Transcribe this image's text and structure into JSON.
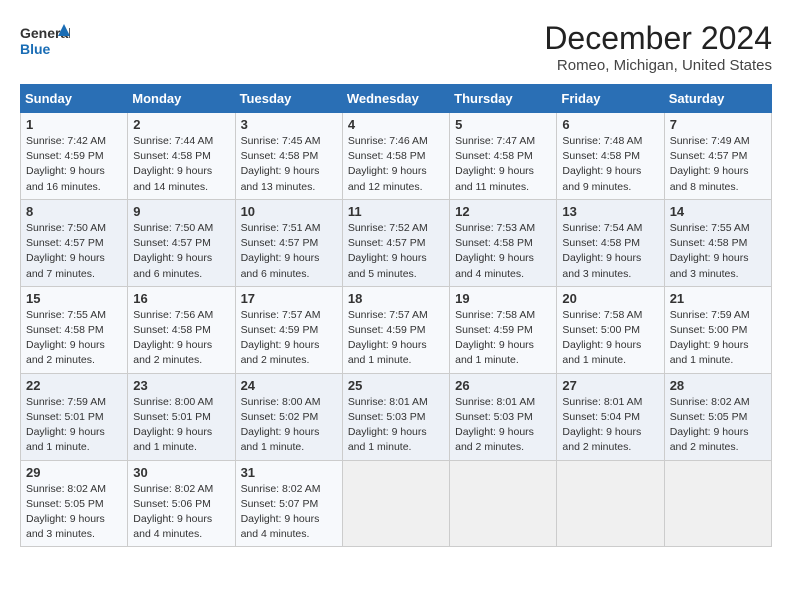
{
  "header": {
    "logo_line1": "General",
    "logo_line2": "Blue",
    "month": "December 2024",
    "location": "Romeo, Michigan, United States"
  },
  "weekdays": [
    "Sunday",
    "Monday",
    "Tuesday",
    "Wednesday",
    "Thursday",
    "Friday",
    "Saturday"
  ],
  "weeks": [
    [
      {
        "day": "1",
        "info": "Sunrise: 7:42 AM\nSunset: 4:59 PM\nDaylight: 9 hours\nand 16 minutes."
      },
      {
        "day": "2",
        "info": "Sunrise: 7:44 AM\nSunset: 4:58 PM\nDaylight: 9 hours\nand 14 minutes."
      },
      {
        "day": "3",
        "info": "Sunrise: 7:45 AM\nSunset: 4:58 PM\nDaylight: 9 hours\nand 13 minutes."
      },
      {
        "day": "4",
        "info": "Sunrise: 7:46 AM\nSunset: 4:58 PM\nDaylight: 9 hours\nand 12 minutes."
      },
      {
        "day": "5",
        "info": "Sunrise: 7:47 AM\nSunset: 4:58 PM\nDaylight: 9 hours\nand 11 minutes."
      },
      {
        "day": "6",
        "info": "Sunrise: 7:48 AM\nSunset: 4:58 PM\nDaylight: 9 hours\nand 9 minutes."
      },
      {
        "day": "7",
        "info": "Sunrise: 7:49 AM\nSunset: 4:57 PM\nDaylight: 9 hours\nand 8 minutes."
      }
    ],
    [
      {
        "day": "8",
        "info": "Sunrise: 7:50 AM\nSunset: 4:57 PM\nDaylight: 9 hours\nand 7 minutes."
      },
      {
        "day": "9",
        "info": "Sunrise: 7:50 AM\nSunset: 4:57 PM\nDaylight: 9 hours\nand 6 minutes."
      },
      {
        "day": "10",
        "info": "Sunrise: 7:51 AM\nSunset: 4:57 PM\nDaylight: 9 hours\nand 6 minutes."
      },
      {
        "day": "11",
        "info": "Sunrise: 7:52 AM\nSunset: 4:57 PM\nDaylight: 9 hours\nand 5 minutes."
      },
      {
        "day": "12",
        "info": "Sunrise: 7:53 AM\nSunset: 4:58 PM\nDaylight: 9 hours\nand 4 minutes."
      },
      {
        "day": "13",
        "info": "Sunrise: 7:54 AM\nSunset: 4:58 PM\nDaylight: 9 hours\nand 3 minutes."
      },
      {
        "day": "14",
        "info": "Sunrise: 7:55 AM\nSunset: 4:58 PM\nDaylight: 9 hours\nand 3 minutes."
      }
    ],
    [
      {
        "day": "15",
        "info": "Sunrise: 7:55 AM\nSunset: 4:58 PM\nDaylight: 9 hours\nand 2 minutes."
      },
      {
        "day": "16",
        "info": "Sunrise: 7:56 AM\nSunset: 4:58 PM\nDaylight: 9 hours\nand 2 minutes."
      },
      {
        "day": "17",
        "info": "Sunrise: 7:57 AM\nSunset: 4:59 PM\nDaylight: 9 hours\nand 2 minutes."
      },
      {
        "day": "18",
        "info": "Sunrise: 7:57 AM\nSunset: 4:59 PM\nDaylight: 9 hours\nand 1 minute."
      },
      {
        "day": "19",
        "info": "Sunrise: 7:58 AM\nSunset: 4:59 PM\nDaylight: 9 hours\nand 1 minute."
      },
      {
        "day": "20",
        "info": "Sunrise: 7:58 AM\nSunset: 5:00 PM\nDaylight: 9 hours\nand 1 minute."
      },
      {
        "day": "21",
        "info": "Sunrise: 7:59 AM\nSunset: 5:00 PM\nDaylight: 9 hours\nand 1 minute."
      }
    ],
    [
      {
        "day": "22",
        "info": "Sunrise: 7:59 AM\nSunset: 5:01 PM\nDaylight: 9 hours\nand 1 minute."
      },
      {
        "day": "23",
        "info": "Sunrise: 8:00 AM\nSunset: 5:01 PM\nDaylight: 9 hours\nand 1 minute."
      },
      {
        "day": "24",
        "info": "Sunrise: 8:00 AM\nSunset: 5:02 PM\nDaylight: 9 hours\nand 1 minute."
      },
      {
        "day": "25",
        "info": "Sunrise: 8:01 AM\nSunset: 5:03 PM\nDaylight: 9 hours\nand 1 minute."
      },
      {
        "day": "26",
        "info": "Sunrise: 8:01 AM\nSunset: 5:03 PM\nDaylight: 9 hours\nand 2 minutes."
      },
      {
        "day": "27",
        "info": "Sunrise: 8:01 AM\nSunset: 5:04 PM\nDaylight: 9 hours\nand 2 minutes."
      },
      {
        "day": "28",
        "info": "Sunrise: 8:02 AM\nSunset: 5:05 PM\nDaylight: 9 hours\nand 2 minutes."
      }
    ],
    [
      {
        "day": "29",
        "info": "Sunrise: 8:02 AM\nSunset: 5:05 PM\nDaylight: 9 hours\nand 3 minutes."
      },
      {
        "day": "30",
        "info": "Sunrise: 8:02 AM\nSunset: 5:06 PM\nDaylight: 9 hours\nand 4 minutes."
      },
      {
        "day": "31",
        "info": "Sunrise: 8:02 AM\nSunset: 5:07 PM\nDaylight: 9 hours\nand 4 minutes."
      },
      {
        "day": "",
        "info": ""
      },
      {
        "day": "",
        "info": ""
      },
      {
        "day": "",
        "info": ""
      },
      {
        "day": "",
        "info": ""
      }
    ]
  ]
}
